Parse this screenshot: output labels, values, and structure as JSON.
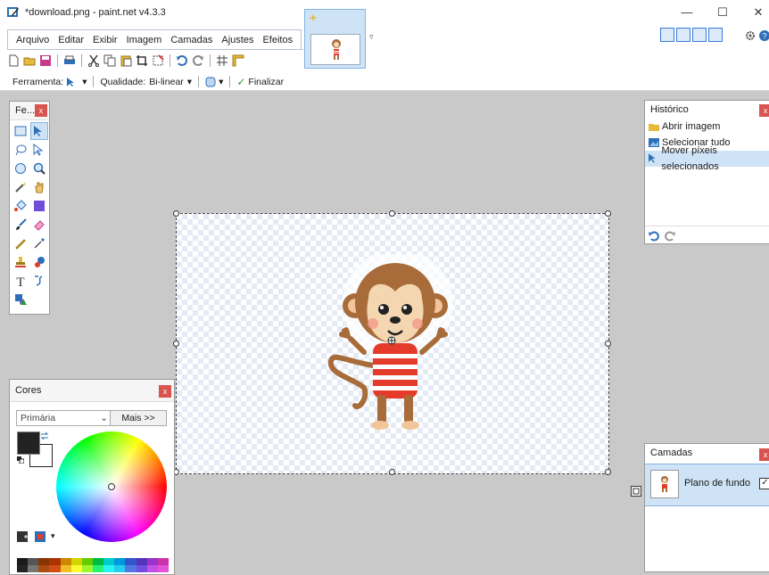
{
  "window": {
    "title": "*download.png - paint.net v4.3.3",
    "minimize": "—",
    "maximize": "☐",
    "close": "✕"
  },
  "menu": [
    "Arquivo",
    "Editar",
    "Exibir",
    "Imagem",
    "Camadas",
    "Ajustes",
    "Efeitos"
  ],
  "tool_options": {
    "tool_label": "Ferramenta:",
    "quality_label": "Qualidade:",
    "quality_value": "Bi-linear",
    "finish_label": "Finalizar"
  },
  "tools_panel": {
    "title": "Fe...",
    "close": "x",
    "tools": [
      "rectangle-select-icon",
      "move-selected-pixels-icon",
      "lasso-select-icon",
      "move-selection-icon",
      "ellipse-select-icon",
      "zoom-icon",
      "magic-wand-icon",
      "pan-icon",
      "paint-bucket-icon",
      "gradient-icon",
      "paintbrush-icon",
      "eraser-icon",
      "pencil-icon",
      "color-picker-icon",
      "clone-stamp-icon",
      "recolor-icon",
      "text-icon",
      "line-curve-icon",
      "shapes-icon"
    ]
  },
  "history": {
    "title": "Histórico",
    "close": "x",
    "items": [
      "Abrir imagem",
      "Selecionar tudo",
      "Mover píxeis selecionados"
    ],
    "selected_index": 2
  },
  "colors": {
    "title": "Cores",
    "close": "x",
    "selector": "Primária",
    "more_button": "Mais >>",
    "primary_color": "#222222",
    "secondary_color": "#ffffff"
  },
  "layers": {
    "title": "Camadas",
    "close": "x",
    "layer_name": "Plano de fundo",
    "visible": true
  },
  "colors_palette": [
    "#1a1a1a",
    "#555555",
    "#883300",
    "#aa3300",
    "#cc8800",
    "#d4d400",
    "#66cc00",
    "#00bb44",
    "#00cccc",
    "#0099dd",
    "#3355cc",
    "#5533bb",
    "#9933cc",
    "#cc33aa"
  ]
}
